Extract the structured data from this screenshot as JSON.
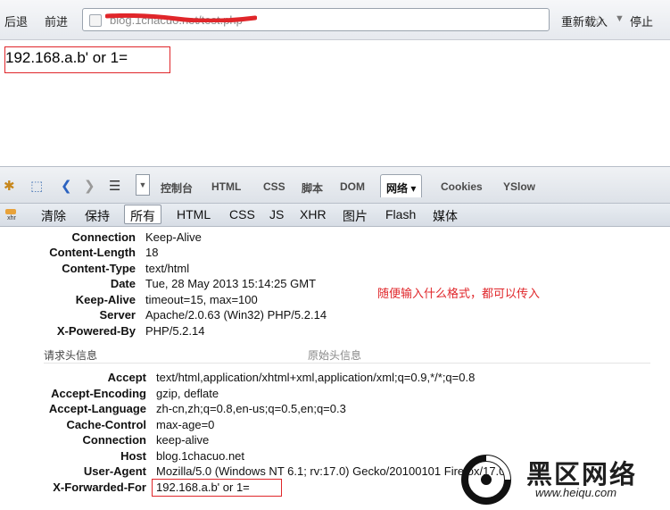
{
  "browser": {
    "back_label": "后退",
    "forward_label": "前进",
    "url_text": "blog.1chacuo.net/test.php",
    "reload_label": "重新载入",
    "stop_label": "停止"
  },
  "page": {
    "payload_text": "192.168.a.b' or 1="
  },
  "firebug": {
    "panel_tabs": [
      "控制台",
      "HTML",
      "CSS",
      "脚本",
      "DOM",
      "网络 ▾",
      "Cookies",
      "YSlow"
    ],
    "active_panel": "网络 ▾",
    "net_filters": [
      "清除",
      "保持",
      "所有",
      "HTML",
      "CSS",
      "JS",
      "XHR",
      "图片",
      "Flash",
      "媒体"
    ],
    "active_filter": "所有",
    "xhr_icon_label": "xhr"
  },
  "response_headers": [
    {
      "key": "Connection",
      "value": "Keep-Alive"
    },
    {
      "key": "Content-Length",
      "value": "18"
    },
    {
      "key": "Content-Type",
      "value": "text/html"
    },
    {
      "key": "Date",
      "value": "Tue, 28 May 2013 15:14:25 GMT"
    },
    {
      "key": "Keep-Alive",
      "value": "timeout=15, max=100"
    },
    {
      "key": "Server",
      "value": "Apache/2.0.63 (Win32) PHP/5.2.14"
    },
    {
      "key": "X-Powered-By",
      "value": "PHP/5.2.14"
    }
  ],
  "annotation": "随便输入什么格式，都可以传入",
  "request_section_title": "请求头信息",
  "raw_headers_label": "原始头信息",
  "request_headers": [
    {
      "key": "Accept",
      "value": "text/html,application/xhtml+xml,application/xml;q=0.9,*/*;q=0.8"
    },
    {
      "key": "Accept-Encoding",
      "value": "gzip, deflate"
    },
    {
      "key": "Accept-Language",
      "value": "zh-cn,zh;q=0.8,en-us;q=0.5,en;q=0.3"
    },
    {
      "key": "Cache-Control",
      "value": "max-age=0"
    },
    {
      "key": "Connection",
      "value": "keep-alive"
    },
    {
      "key": "Host",
      "value": "blog.1chacuo.net"
    },
    {
      "key": "User-Agent",
      "value": "Mozilla/5.0 (Windows NT 6.1; rv:17.0) Gecko/20100101 Firefox/17.0"
    },
    {
      "key": "X-Forwarded-For",
      "value": "192.168.a.b' or 1="
    }
  ],
  "watermark": {
    "title": "黑区网络",
    "url": "www.heiqu.com"
  },
  "colors": {
    "highlight_red": "#e0262a"
  }
}
